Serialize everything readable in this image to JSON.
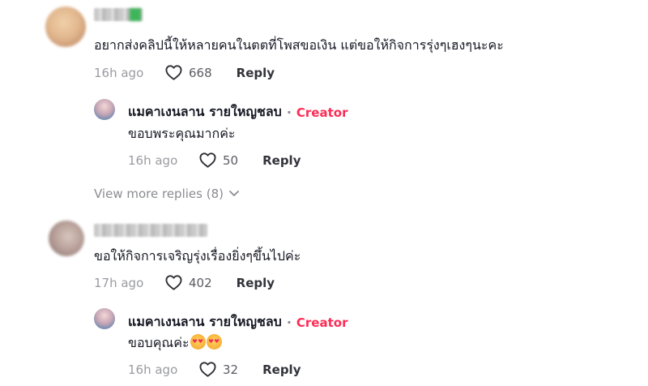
{
  "comments": [
    {
      "text": "อยากส่งคลิปนี้ให้หลายคนในตตที่โพสขอเงิน แต่ขอให้กิจการรุ่งๆเฮงๆนะคะ",
      "time": "16h ago",
      "likes": "668",
      "reply_label": "Reply",
      "reply": {
        "author": "แมคาเงนลาน รายใหญชลบ",
        "separator": "·",
        "badge": "Creator",
        "text": "ขอบพระคุณมากค่ะ",
        "time": "16h ago",
        "likes": "50",
        "reply_label": "Reply"
      },
      "view_more": "View more replies (8)"
    },
    {
      "text": "ขอให้กิจการเจริญรุ่งเรื่องยิ่งๆขึ้นไปค่ะ",
      "time": "17h ago",
      "likes": "402",
      "reply_label": "Reply",
      "reply": {
        "author": "แมคาเงนลาน รายใหญชลบ",
        "separator": "·",
        "badge": "Creator",
        "text": "ขอบคุณค่ะ",
        "emojis": [
          "heart-eyes-emoji",
          "heart-eyes-emoji"
        ],
        "time": "16h ago",
        "likes": "32",
        "reply_label": "Reply"
      }
    }
  ],
  "colors": {
    "creator_badge": "#fe2c55",
    "muted": "#8a8b91",
    "text": "#161823"
  }
}
